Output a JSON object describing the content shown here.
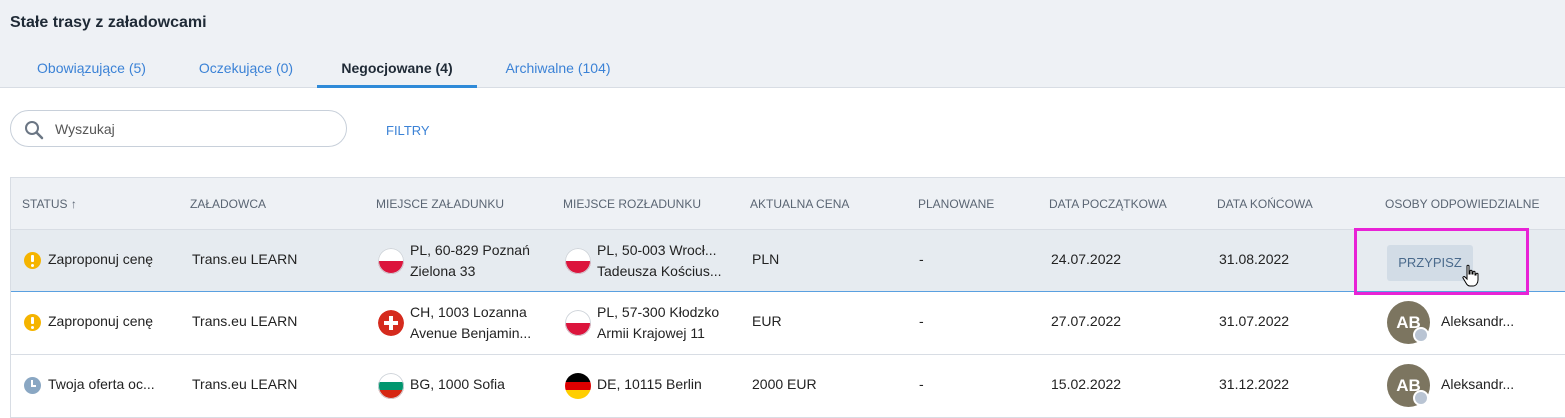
{
  "header": {
    "title": "Stałe trasy z załadowcami",
    "tabs": [
      {
        "label": "Obowiązujące (5)"
      },
      {
        "label": "Oczekujące (0)"
      },
      {
        "label": "Negocjowane (4)"
      },
      {
        "label": "Archiwalne (104)"
      }
    ],
    "active_tab": "Negocjowane (4)"
  },
  "search": {
    "placeholder": "Wyszukaj",
    "value": ""
  },
  "filters_label": "FILTRY",
  "table": {
    "columns": [
      "STATUS ↑",
      "ZAŁADOWCA",
      "MIEJSCE ZAŁADUNKU",
      "MIEJSCE ROZŁADUNKU",
      "AKTUALNA CENA",
      "PLANOWANE",
      "DATA POCZĄTKOWA",
      "DATA KOŃCOWA",
      "OSOBY ODPOWIEDZIALNE"
    ],
    "rows": [
      {
        "status_icon": "warning-icon",
        "status": "Zaproponuj cenę",
        "shipper": "Trans.eu LEARN",
        "loading_flag": "poland-flag-icon",
        "loading_line1": "PL, 60-829 Poznań",
        "loading_line2": "Zielona 33",
        "unloading_flag": "poland-flag-icon",
        "unloading_line1": "PL, 50-003 Wrocł...",
        "unloading_line2": "Tadeusza Kościus...",
        "price": "PLN",
        "planned": "-",
        "date_start": "24.07.2022",
        "date_end": "31.08.2022",
        "responsible_button": "PRZYPISZ"
      },
      {
        "status_icon": "warning-icon",
        "status": "Zaproponuj cenę",
        "shipper": "Trans.eu LEARN",
        "loading_flag": "switzerland-flag-icon",
        "loading_line1": "CH, 1003 Lozanna",
        "loading_line2": "Avenue Benjamin...",
        "unloading_flag": "poland-flag-icon",
        "unloading_line1": "PL, 57-300 Kłodzko",
        "unloading_line2": "Armii Krajowej 11",
        "price": "EUR",
        "planned": "-",
        "date_start": "27.07.2022",
        "date_end": "31.07.2022",
        "responsible_initials": "AB",
        "responsible_name": "Aleksandr..."
      },
      {
        "status_icon": "clock-icon",
        "status": "Twoja oferta oc...",
        "shipper": "Trans.eu LEARN",
        "loading_flag": "bulgaria-flag-icon",
        "loading_line1": "BG, 1000 Sofia",
        "unloading_flag": "germany-flag-icon",
        "unloading_line1": "DE, 10115 Berlin",
        "price": "2000 EUR",
        "planned": "-",
        "date_start": "15.02.2022",
        "date_end": "31.12.2022",
        "responsible_initials": "AB",
        "responsible_name": "Aleksandr..."
      }
    ]
  },
  "colors": {
    "accent": "#2f8ad8",
    "link": "#3b82d6",
    "warning": "#f5b400",
    "highlight": "#e822d6"
  }
}
